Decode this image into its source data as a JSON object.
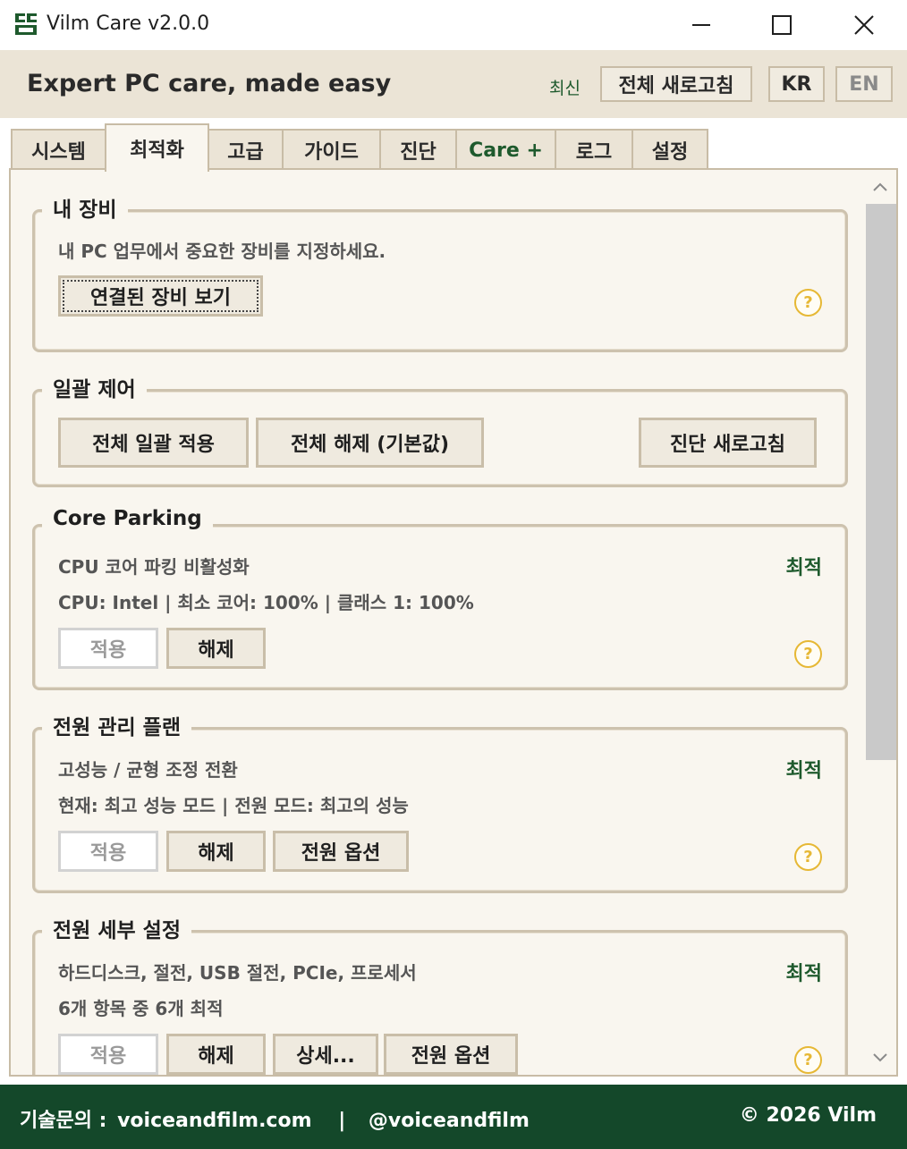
{
  "window": {
    "title": "Vilm Care v2.0.0"
  },
  "header": {
    "tagline": "Expert PC care, made easy",
    "status": "최신",
    "refresh_all": "전체 새로고침",
    "lang_kr": "KR",
    "lang_en": "EN"
  },
  "tabs": [
    {
      "label": "시스템"
    },
    {
      "label": "최적화"
    },
    {
      "label": "고급"
    },
    {
      "label": "가이드"
    },
    {
      "label": "진단"
    },
    {
      "label": "Care +"
    },
    {
      "label": "로그"
    },
    {
      "label": "설정"
    }
  ],
  "active_tab": "최적화",
  "groups": {
    "devices": {
      "title": "내 장비",
      "desc": "내 PC 업무에서 중요한 장비를 지정하세요.",
      "view_button": "연결된 장비 보기"
    },
    "batch": {
      "title": "일괄 제어",
      "apply_all": "전체 일괄 적용",
      "reset_all": "전체 해제 (기본값)",
      "diag_refresh": "진단 새로고침"
    },
    "core_parking": {
      "title": "Core Parking",
      "desc1": "CPU 코어 파킹 비활성화",
      "desc2": "CPU: Intel | 최소 코어: 100% | 클래스 1: 100%",
      "status": "최적",
      "apply": "적용",
      "release": "해제"
    },
    "power_plan": {
      "title": "전원 관리 플랜",
      "desc1": "고성능 / 균형 조정 전환",
      "desc2": "현재: 최고 성능 모드 | 전원 모드: 최고의 성능",
      "status": "최적",
      "apply": "적용",
      "release": "해제",
      "options": "전원 옵션"
    },
    "power_detail": {
      "title": "전원 세부 설정",
      "desc1": "하드디스크, 절전, USB 절전, PCIe, 프로세서",
      "desc2": "6개 항목 중 6개 최적",
      "status": "최적",
      "apply": "적용",
      "release": "해제",
      "details": "상세...",
      "options": "전원 옵션"
    }
  },
  "help_glyph": "?",
  "icons": {
    "app": "app-logo-icon",
    "minimize": "minimize-icon",
    "maximize": "maximize-icon",
    "close": "close-icon",
    "help": "help-circle-icon"
  },
  "colors": {
    "accent_green": "#1e5a2d",
    "footer_bg": "#14482a",
    "header_bg": "#ebe4d6",
    "panel_bg": "#f9f6ef",
    "border": "#c8bca6",
    "help_yellow": "#e6b835"
  },
  "footer": {
    "contact_label": "기술문의 :",
    "site": "voiceandfilm.com",
    "separator": "|",
    "handle": "@voiceandfilm",
    "copyright": "© 2026 Vilm"
  }
}
